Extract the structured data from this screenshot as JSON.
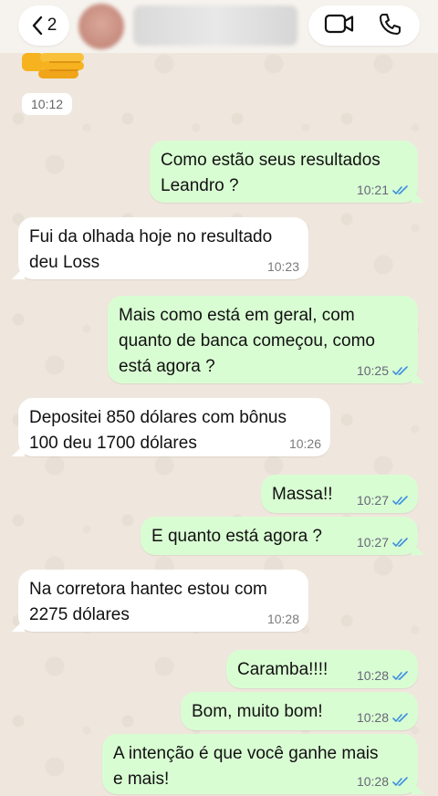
{
  "header": {
    "back_count": "2"
  },
  "top_time": "10:12",
  "messages": [
    {
      "text_line1": "Como estão seus resultados",
      "text_line2": "Leandro ?",
      "time": "10:21"
    },
    {
      "text_line1": "Fui da olhada hoje no resultado",
      "text_line2": "deu Loss",
      "time": "10:23"
    },
    {
      "text_line1": "Mais como está em geral, com",
      "text_line2": "quanto de banca começou, como",
      "text_line3": "está agora ?",
      "time": "10:25"
    },
    {
      "text_line1": "Depositei 850 dólares com bônus",
      "text_line2": "100 deu 1700 dólares",
      "time": "10:26"
    },
    {
      "text_line1": "Massa!!",
      "time": "10:27"
    },
    {
      "text_line1": "E quanto está agora ?",
      "time": "10:27"
    },
    {
      "text_line1": "Na corretora hantec estou com",
      "text_line2": "2275 dólares",
      "time": "10:28"
    },
    {
      "text_line1": "Caramba!!!!",
      "time": "10:28"
    },
    {
      "text_line1": "Bom, muito bom!",
      "time": "10:28"
    },
    {
      "text_line1": "A intenção é que você ganhe mais",
      "text_line2": "e mais!",
      "time": "10:28"
    }
  ],
  "colors": {
    "outgoing_bubble": "#d9fdd3",
    "incoming_bubble": "#ffffff",
    "read_ticks": "#3d8fe0",
    "wallpaper": "#efe7dd"
  }
}
